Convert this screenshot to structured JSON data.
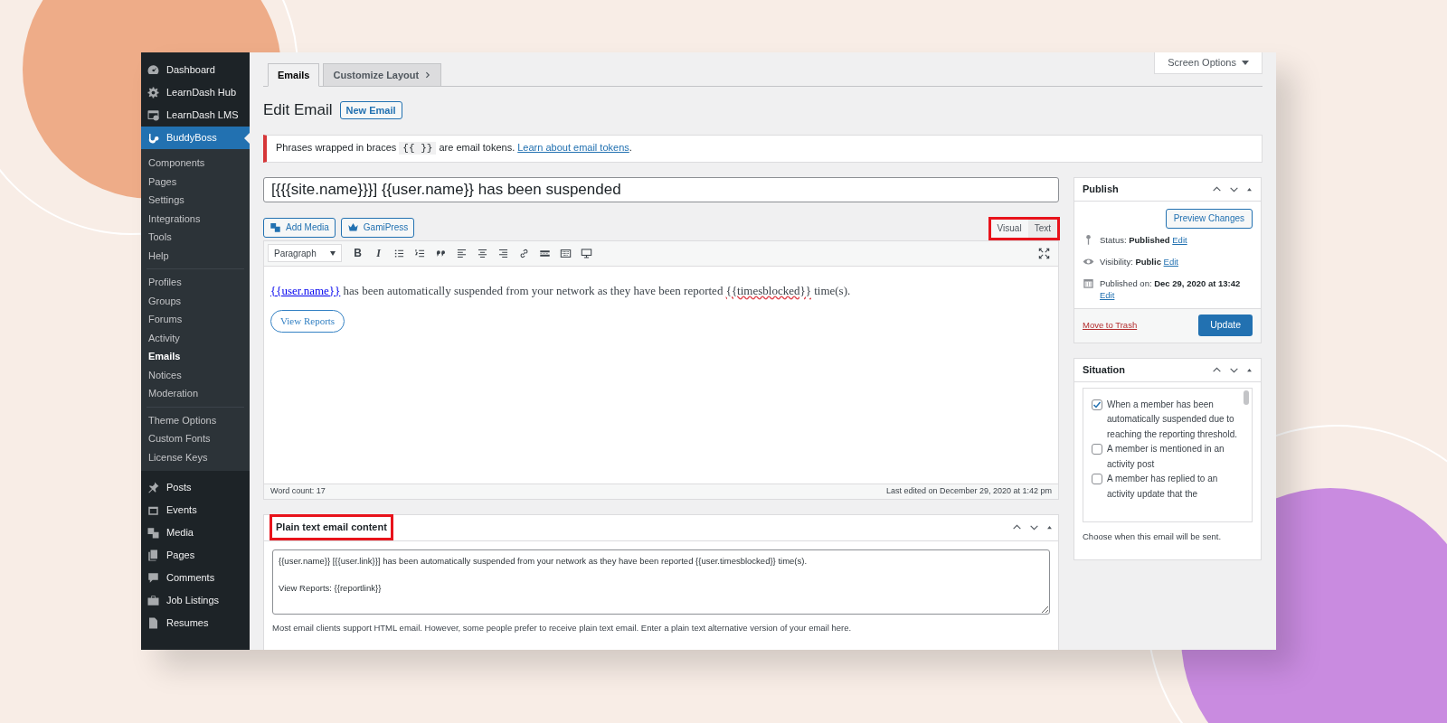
{
  "sidebar": {
    "items": [
      {
        "label": "Dashboard",
        "selected": false
      },
      {
        "label": "LearnDash Hub",
        "selected": false
      },
      {
        "label": "LearnDash LMS",
        "selected": false
      },
      {
        "label": "BuddyBoss",
        "selected": true,
        "submenu": [
          [
            {
              "label": "Components",
              "selected": false
            },
            {
              "label": "Pages",
              "selected": false
            },
            {
              "label": "Settings",
              "selected": false
            },
            {
              "label": "Integrations",
              "selected": false
            },
            {
              "label": "Tools",
              "selected": false
            },
            {
              "label": "Help",
              "selected": false
            }
          ],
          [
            {
              "label": "Profiles",
              "selected": false
            },
            {
              "label": "Groups",
              "selected": false
            },
            {
              "label": "Forums",
              "selected": false
            },
            {
              "label": "Activity",
              "selected": false
            },
            {
              "label": "Emails",
              "selected": true
            },
            {
              "label": "Notices",
              "selected": false
            },
            {
              "label": "Moderation",
              "selected": false
            }
          ],
          [
            {
              "label": "Theme Options",
              "selected": false
            },
            {
              "label": "Custom Fonts",
              "selected": false
            },
            {
              "label": "License Keys",
              "selected": false
            }
          ]
        ]
      },
      {
        "label": "Posts",
        "selected": false
      },
      {
        "label": "Events",
        "selected": false
      },
      {
        "label": "Media",
        "selected": false
      },
      {
        "label": "Pages",
        "selected": false
      },
      {
        "label": "Comments",
        "selected": false
      },
      {
        "label": "Job Listings",
        "selected": false
      },
      {
        "label": "Resumes",
        "selected": false
      }
    ]
  },
  "tabs": [
    {
      "label": "Emails",
      "selected": true
    },
    {
      "label": "Customize Layout",
      "selected": false
    }
  ],
  "screen_options": "Screen Options",
  "heading": "Edit Email",
  "new_button": "New Email",
  "notice": {
    "before": "Phrases wrapped in braces",
    "code": "{{ }}",
    "after": "are email tokens.",
    "link": "Learn about email tokens",
    "end": "."
  },
  "title_value": "[{{{site.name}}}] {{user.name}} has been suspended",
  "media_buttons": [
    "Add Media",
    "GamiPress"
  ],
  "editor_mode": {
    "highlighted": true,
    "tabs": [
      {
        "label": "Visual",
        "selected": true
      },
      {
        "label": "Text",
        "selected": false
      }
    ]
  },
  "format_select": "Paragraph",
  "toolbar": [
    {
      "kind": "bold",
      "label": "B"
    },
    {
      "kind": "italic",
      "label": "I"
    },
    {
      "kind": "bullets"
    },
    {
      "kind": "numbers"
    },
    {
      "kind": "quote"
    },
    {
      "kind": "left"
    },
    {
      "kind": "center"
    },
    {
      "kind": "right"
    },
    {
      "kind": "link"
    },
    {
      "kind": "more"
    },
    {
      "kind": "keyboard"
    },
    {
      "kind": "monitor"
    }
  ],
  "content": {
    "segments": [
      {
        "kind": "link",
        "text": "{{user.name}}"
      },
      {
        "kind": "text",
        "text": " has been automatically suspended from your network as they have been reported "
      },
      {
        "kind": "misspelled",
        "text": "{{timesblocked}}"
      },
      {
        "kind": "text",
        "text": " time(s)."
      }
    ],
    "button": "View Reports"
  },
  "word_count": "Word count: 17",
  "last_edited": "Last edited on December 29, 2020 at 1:42 pm",
  "plain_text": {
    "title": "Plain text email content",
    "highlighted": true,
    "value": "{{user.name}} [{{user.link}}] has been automatically suspended from your network as they have been reported {{user.timesblocked}} time(s).\n\nView Reports: {{reportlink}}",
    "help": "Most email clients support HTML email. However, some people prefer to receive plain text email. Enter a plain text alternative version of your email here."
  },
  "publish": {
    "title": "Publish",
    "preview": "Preview Changes",
    "rows": [
      {
        "label": "Status:",
        "value": "Published",
        "link": "Edit"
      },
      {
        "label": "Visibility:",
        "value": "Public",
        "link": "Edit"
      },
      {
        "label": "Published on:",
        "value": "Dec 29, 2020 at 13:42",
        "link": "Edit"
      }
    ],
    "trash": "Move to Trash",
    "update": "Update"
  },
  "situation": {
    "title": "Situation",
    "options": [
      {
        "label": "When a member has been automatically suspended due to reaching the reporting threshold.",
        "checked": true
      },
      {
        "label": "A member is mentioned in an activity post",
        "checked": false
      },
      {
        "label": "A member has replied to an activity update that the",
        "checked": false
      }
    ],
    "help": "Choose when this email will be sent."
  }
}
